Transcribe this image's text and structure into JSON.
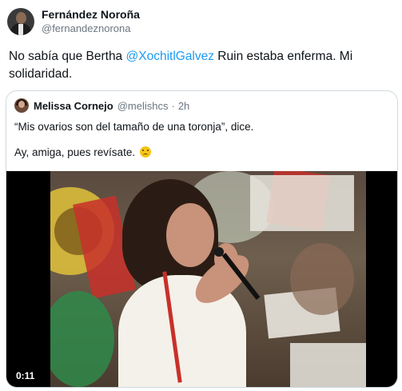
{
  "author": {
    "display_name": "Fernández Noroña",
    "handle": "@fernandeznorona"
  },
  "tweet": {
    "text_before": "No sabía que Bertha ",
    "mention": "@XochitlGalvez",
    "text_after": " Ruin estaba enferma. Mi solidaridad."
  },
  "quote": {
    "display_name": "Melissa Cornejo",
    "handle": "@melishcs",
    "separator": "·",
    "time": "2h",
    "line1": "“Mis ovarios son del tamaño de una toronja”, dice.",
    "line2": "Ay, amiga, pues revísate.",
    "emoji": "crying-face-emoji",
    "video": {
      "duration": "0:11"
    }
  },
  "colors": {
    "mention": "#1d9bf0",
    "secondary_text": "#6b7680",
    "border": "#cfd9de"
  }
}
